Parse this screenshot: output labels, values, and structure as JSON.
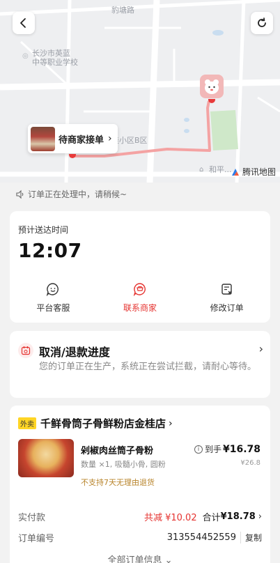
{
  "map": {
    "labels": {
      "road_top": "豹塘路",
      "school_line1": "长沙市英蓝",
      "school_line2": "中等职业学校",
      "district": "佳小区B区",
      "heping": "和平..."
    },
    "merchant_bubble": "待商家接单",
    "provider": "腾讯地图",
    "back_icon": "chevron-left-icon",
    "refresh_icon": "refresh-icon"
  },
  "status": {
    "processing_text": "订单正在处理中，请稍候~"
  },
  "eta": {
    "title": "预计送达时间",
    "time": "12:07",
    "actions": [
      {
        "label": "平台客服",
        "icon": "smile-chat-icon",
        "color": "#333333"
      },
      {
        "label": "联系商家",
        "icon": "merchant-chat-icon",
        "color": "#e5322f"
      },
      {
        "label": "修改订单",
        "icon": "edit-order-icon",
        "color": "#333333"
      }
    ]
  },
  "refund": {
    "title": "取消/退款进度",
    "desc": "您的订单正在生产，系统正在尝试拦截，请耐心等待。"
  },
  "order": {
    "tag": "外卖",
    "shop_name": "千鲜骨筒子骨鲜粉店金桂店",
    "dish": {
      "name": "剁椒肉丝筒子骨粉",
      "spec": "数量 ×1, 吸髓小骨, 圆粉",
      "policy": "不支持7天无理由退货",
      "price_label": "到手",
      "price": "¥16.78",
      "orig_price": "¥26.8"
    },
    "paid": {
      "label": "实付款",
      "discount": "共减 ¥10.02",
      "total_label": "合计",
      "total": "¥18.78"
    },
    "order_no": {
      "label": "订单编号",
      "value": "313554452559",
      "copy": "复制"
    },
    "all_info": "全部订单信息 ⌄"
  },
  "colors": {
    "accent_red": "#e5322f",
    "tag_yellow": "#ffd525",
    "route": "#f4a3a3"
  }
}
